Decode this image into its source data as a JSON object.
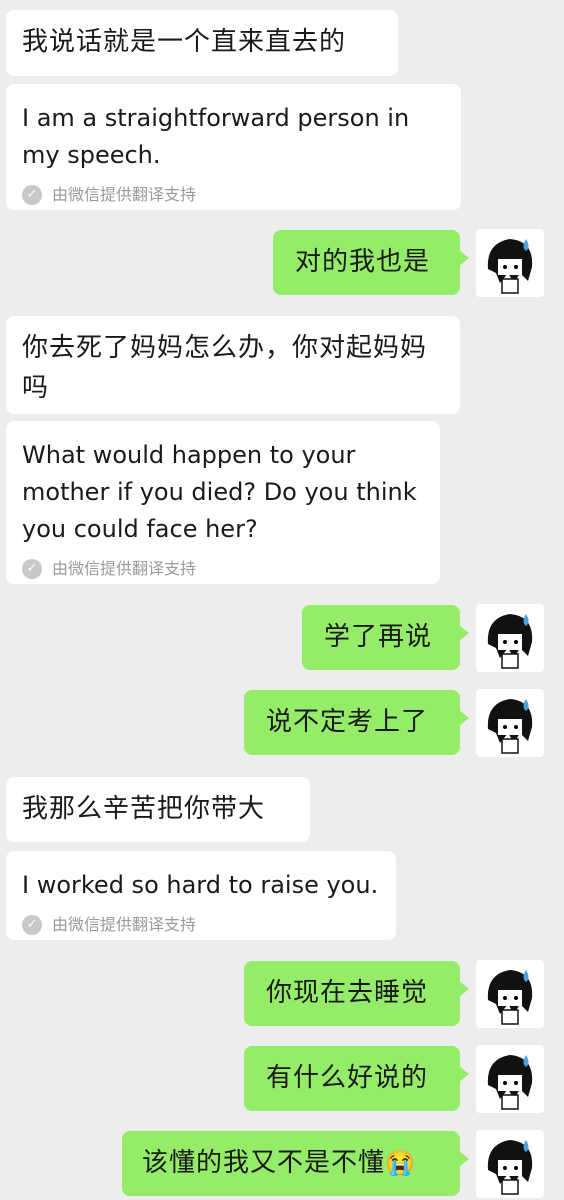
{
  "messages": [
    {
      "side": "left",
      "text": "我说话就是一个直来直去的"
    },
    {
      "side": "left",
      "translation": "I am a straightforward person in my speech.",
      "note": "由微信提供翻译支持"
    },
    {
      "side": "right",
      "text": "对的我也是"
    },
    {
      "side": "left",
      "text": "你去死了妈妈怎么办，你对起妈妈吗"
    },
    {
      "side": "left",
      "translation": "What would happen to your mother if you died? Do you think you could face her?",
      "note": "由微信提供翻译支持"
    },
    {
      "side": "right",
      "text": "学了再说"
    },
    {
      "side": "right",
      "text": "说不定考上了"
    },
    {
      "side": "left",
      "text": "我那么辛苦把你带大"
    },
    {
      "side": "left",
      "translation": "I worked so hard to raise you.",
      "note": "由微信提供翻译支持"
    },
    {
      "side": "right",
      "text": "你现在去睡觉"
    },
    {
      "side": "right",
      "text": "有什么好说的"
    },
    {
      "side": "right",
      "text": "该懂的我又不是不懂",
      "emoji": "😭"
    }
  ],
  "icons": {
    "check": "check-circle-icon",
    "avatar": "anime-avatar"
  },
  "colors": {
    "background": "#ededed",
    "incoming": "#ffffff",
    "outgoing": "#95ec69",
    "note": "#9b9b9b"
  }
}
